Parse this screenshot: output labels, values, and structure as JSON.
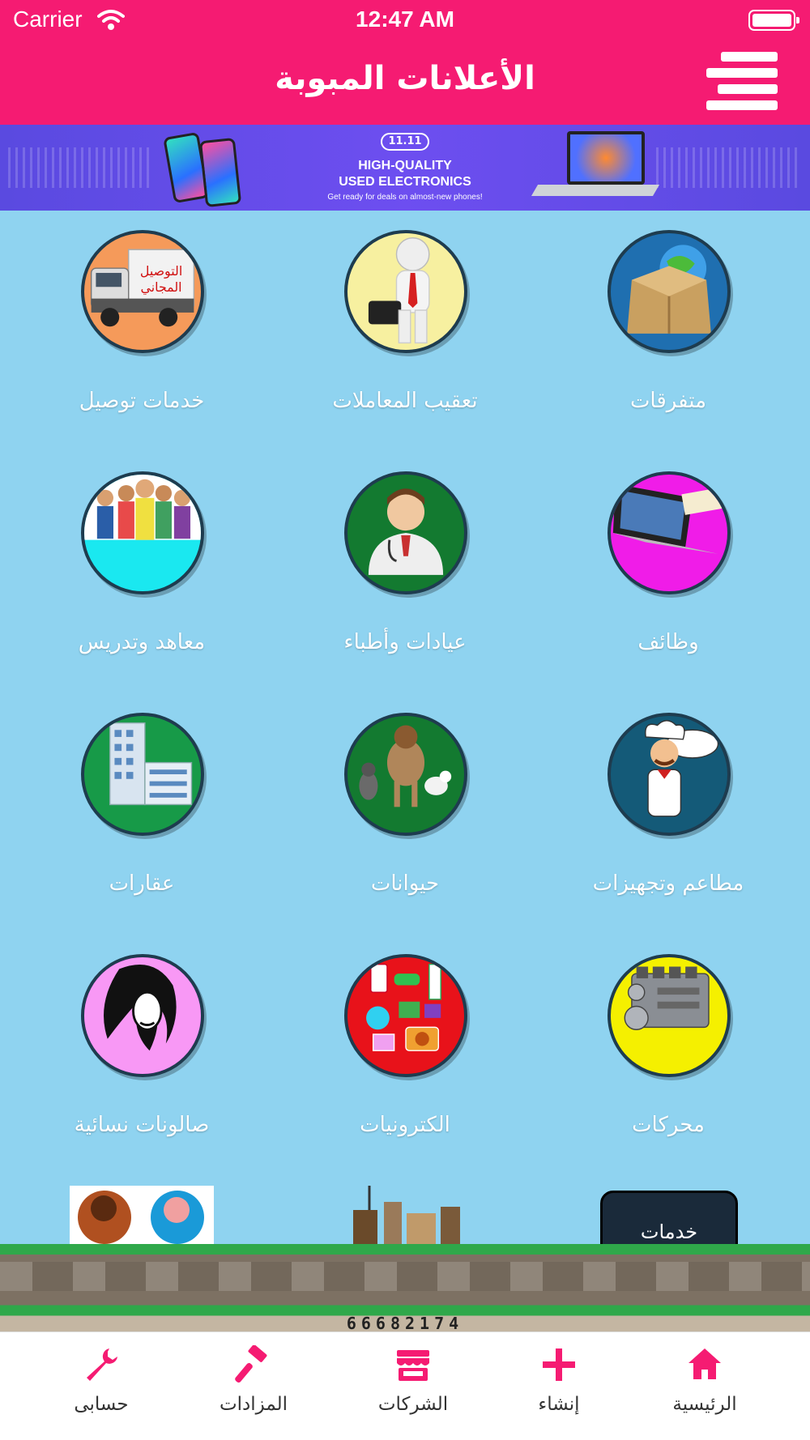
{
  "status": {
    "carrier": "Carrier",
    "time": "12:47 AM"
  },
  "header": {
    "title": "الأعلانات المبوبة"
  },
  "top_banner": {
    "badge": "11.11",
    "line1": "HIGH-QUALITY",
    "line2": "USED ELECTRONICS",
    "line3": "Get ready for deals on almost-new phones!"
  },
  "categories": [
    {
      "label": "متفرقات",
      "color": "#1f6fb0",
      "icon": "box-icon"
    },
    {
      "label": "تعقيب المعاملات",
      "color": "#f7f0a0",
      "icon": "businessman-icon"
    },
    {
      "label": "خدمات توصيل",
      "color": "#f59a5a",
      "icon": "truck-icon"
    },
    {
      "label": "وظائف",
      "color": "#f01ce8",
      "icon": "laptop-job-icon"
    },
    {
      "label": "عيادات وأطباء",
      "color": "#137a30",
      "icon": "doctor-icon"
    },
    {
      "label": "معاهد وتدريس",
      "color": "#1ae8f0",
      "icon": "students-icon"
    },
    {
      "label": "مطاعم وتجهيزات",
      "color": "#145a78",
      "icon": "chef-icon"
    },
    {
      "label": "حيوانات",
      "color": "#137a30",
      "icon": "animals-icon"
    },
    {
      "label": "عقارات",
      "color": "#179a48",
      "icon": "buildings-icon"
    },
    {
      "label": "محركات",
      "color": "#f5f000",
      "icon": "engine-icon"
    },
    {
      "label": "الكترونيات",
      "color": "#e8121a",
      "icon": "electronics-icon"
    },
    {
      "label": "صالونات نسائية",
      "color": "#f01ce8",
      "icon": "woman-icon"
    }
  ],
  "partial_row": [
    {
      "label": "خدمات",
      "icon": "services-icon"
    },
    {
      "label": "",
      "icon": "furniture-icon"
    },
    {
      "label": "",
      "icon": "people-icon"
    }
  ],
  "bottom_banner": {
    "number": "66682174"
  },
  "tabs": [
    {
      "label": "الرئيسية",
      "icon": "home-icon"
    },
    {
      "label": "إنشاء",
      "icon": "plus-icon"
    },
    {
      "label": "الشركات",
      "icon": "store-icon"
    },
    {
      "label": "المزادات",
      "icon": "gavel-icon"
    },
    {
      "label": "حسابى",
      "icon": "wrench-icon"
    }
  ],
  "colors": {
    "brand": "#f51b72",
    "background": "#8fd3f0"
  }
}
